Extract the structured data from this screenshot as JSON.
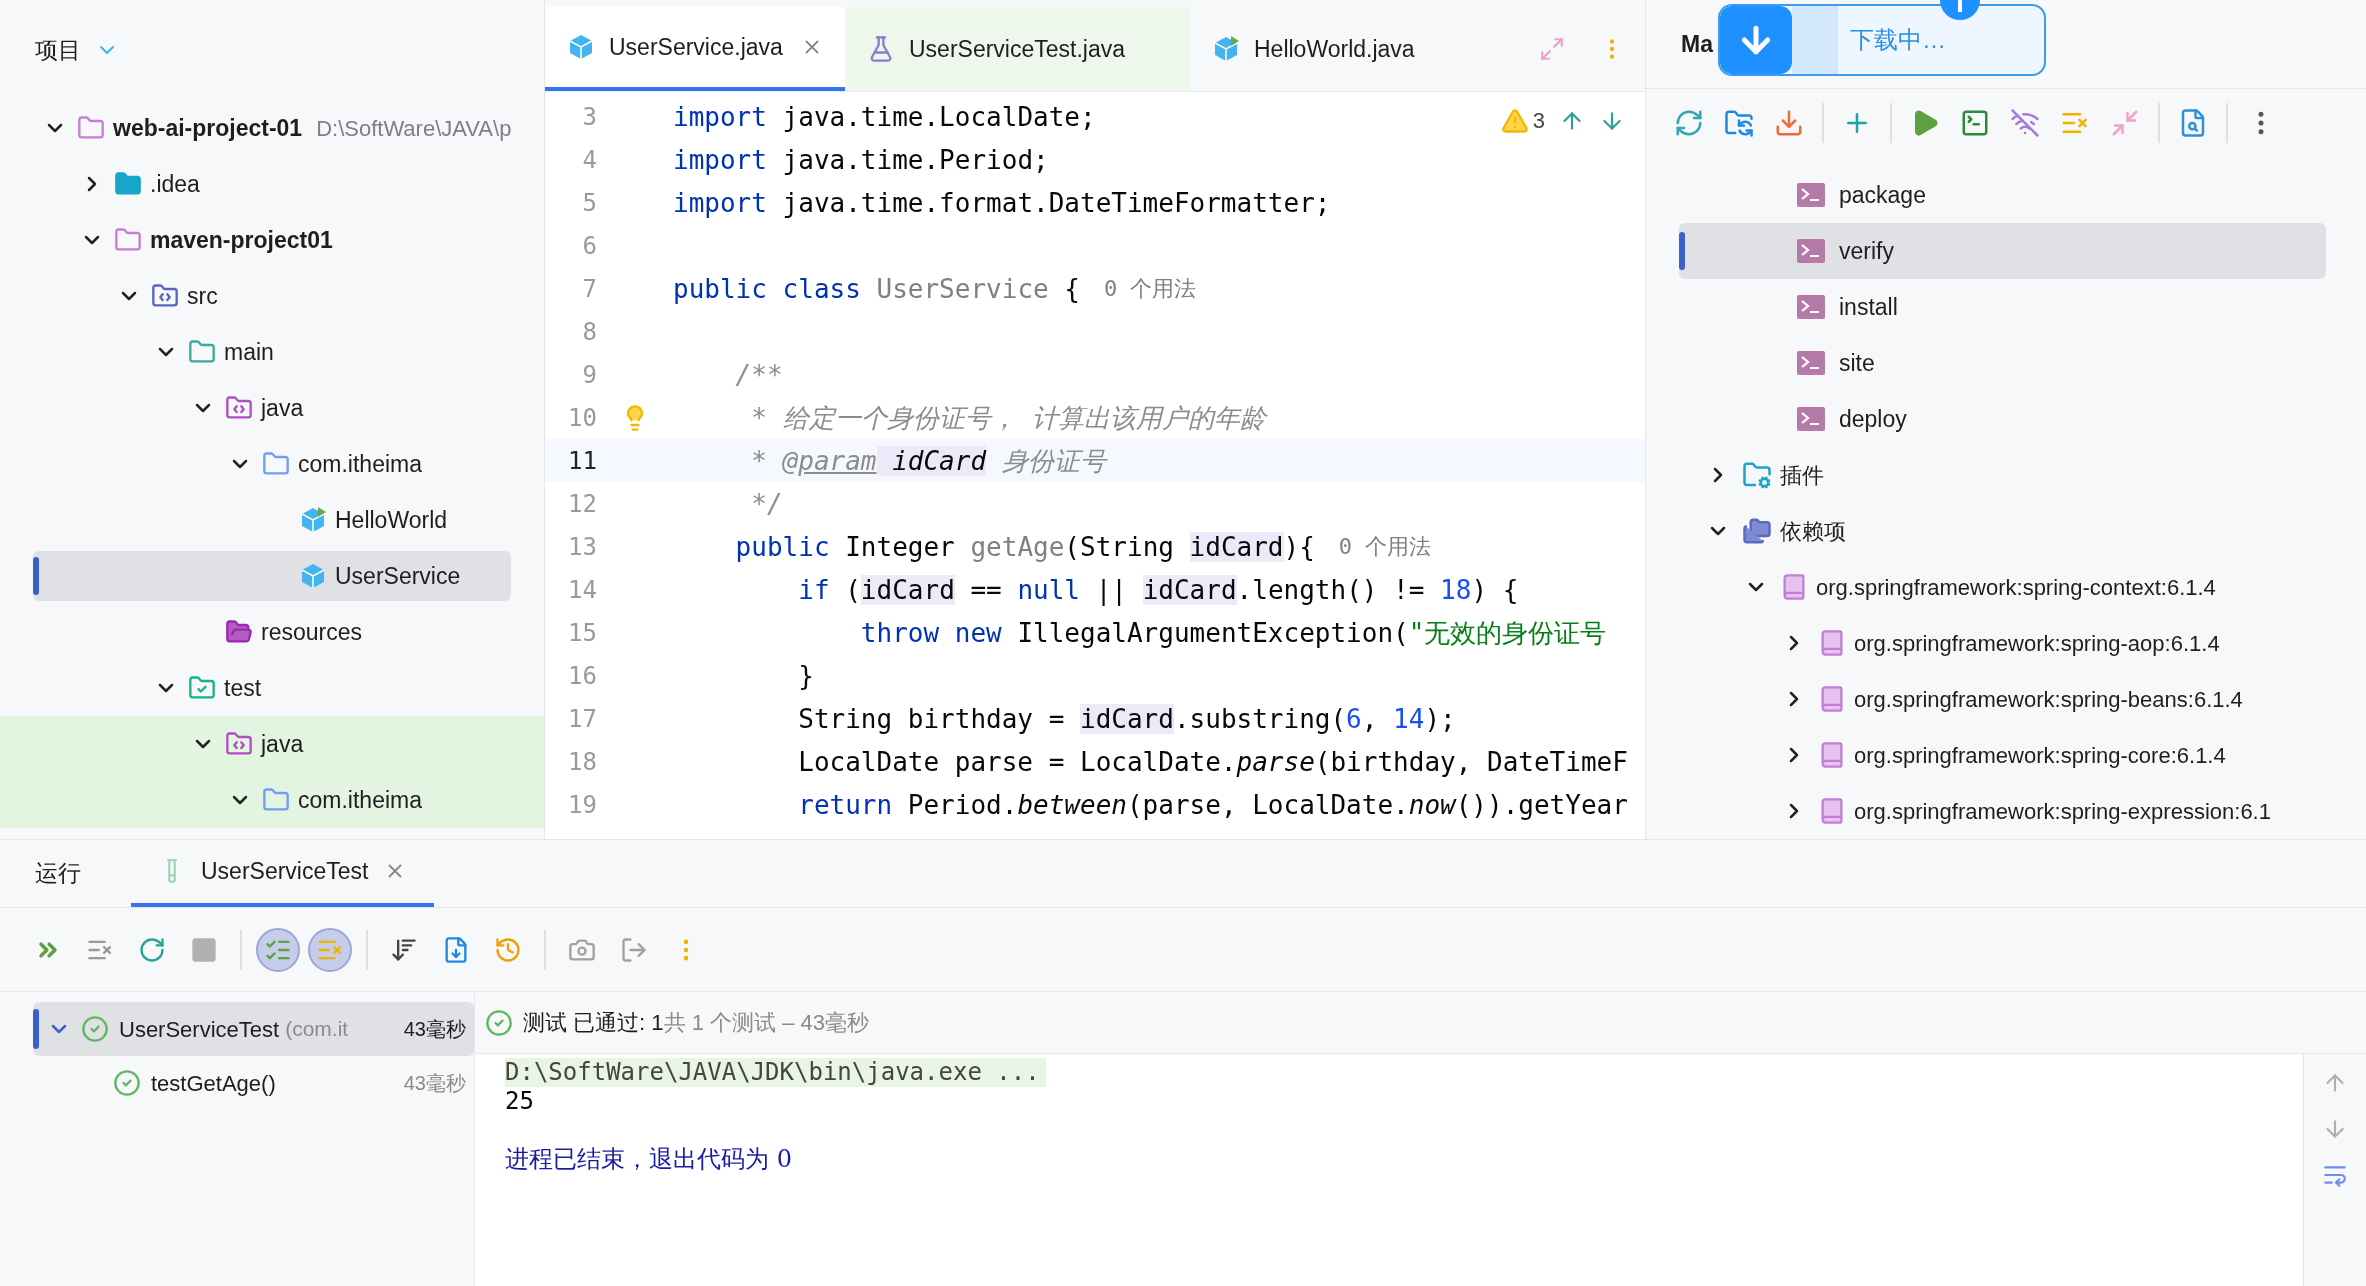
{
  "project_panel": {
    "title": "项目",
    "tree": [
      {
        "label": "web-ai-project-01",
        "kind": "module",
        "hint": "D:\\SoftWare\\JAVA\\p",
        "expanded": true,
        "selected": false,
        "children": [
          {
            "label": ".idea",
            "kind": "idea",
            "expanded": false,
            "selected": false
          },
          {
            "label": "maven-project01",
            "kind": "module",
            "expanded": true,
            "selected": false,
            "children": [
              {
                "label": "src",
                "kind": "src",
                "expanded": true,
                "selected": false,
                "children": [
                  {
                    "label": "main",
                    "kind": "main",
                    "expanded": true,
                    "selected": false,
                    "children": [
                      {
                        "label": "java",
                        "kind": "java",
                        "expanded": true,
                        "selected": false,
                        "children": [
                          {
                            "label": "com.itheima",
                            "kind": "package",
                            "expanded": true,
                            "selected": false,
                            "children": [
                              {
                                "label": "HelloWorld",
                                "kind": "class-run",
                                "selected": false
                              },
                              {
                                "label": "UserService",
                                "kind": "class",
                                "selected": true
                              }
                            ]
                          }
                        ]
                      },
                      {
                        "label": "resources",
                        "kind": "resources",
                        "selected": false
                      }
                    ]
                  },
                  {
                    "label": "test",
                    "kind": "test",
                    "expanded": true,
                    "selected": false,
                    "children": [
                      {
                        "label": "java",
                        "kind": "java-test",
                        "expanded": true,
                        "selected": false,
                        "children": [
                          {
                            "label": "com.itheima",
                            "kind": "package-test",
                            "expanded": true,
                            "selected": false
                          }
                        ]
                      }
                    ]
                  }
                ]
              }
            ]
          }
        ]
      }
    ]
  },
  "editor": {
    "tabs": [
      {
        "label": "UserService.java",
        "kind": "class",
        "selected": true,
        "closable": true
      },
      {
        "label": "UserServiceTest.java",
        "kind": "test",
        "selected": false,
        "closable": false
      },
      {
        "label": "HelloWorld.java",
        "kind": "class-run",
        "selected": false,
        "closable": false
      }
    ],
    "warnings": "3",
    "lines": [
      {
        "number": "3",
        "current": false,
        "tokens": [
          {
            "text": "import",
            "kind": "keyword"
          },
          {
            "text": " java.time.LocalDate;",
            "kind": "plain"
          }
        ]
      },
      {
        "number": "4",
        "current": false,
        "tokens": [
          {
            "text": "import",
            "kind": "keyword"
          },
          {
            "text": " java.time.Period;",
            "kind": "plain"
          }
        ]
      },
      {
        "number": "5",
        "current": false,
        "tokens": [
          {
            "text": "import",
            "kind": "keyword"
          },
          {
            "text": " java.time.format.DateTimeFormatter;",
            "kind": "plain"
          }
        ]
      },
      {
        "number": "6",
        "current": false
      },
      {
        "number": "7",
        "current": false,
        "tokens": [
          {
            "text": "public class ",
            "kind": "keyword"
          },
          {
            "text": "UserService",
            "kind": "unused"
          },
          {
            "text": " {",
            "kind": "plain"
          }
        ],
        "hint": "0 个用法"
      },
      {
        "number": "8",
        "current": false
      },
      {
        "number": "9",
        "current": false,
        "tokens": [
          {
            "text": "    /**",
            "kind": "comment"
          }
        ]
      },
      {
        "number": "10",
        "current": false,
        "intention_bulb": true,
        "tokens": [
          {
            "text": "     * 给定一个身份证号， 计算出该用户的年龄",
            "kind": "comment"
          }
        ]
      },
      {
        "number": "11",
        "current": true,
        "tokens": [
          {
            "text": "     * ",
            "kind": "comment"
          },
          {
            "text": "@param",
            "kind": "doc-tag"
          },
          {
            "text": " idCard",
            "kind": "doc-param"
          },
          {
            "text": " 身份证号",
            "kind": "comment"
          }
        ]
      },
      {
        "number": "12",
        "current": false,
        "tokens": [
          {
            "text": "     */",
            "kind": "comment"
          }
        ]
      },
      {
        "number": "13",
        "current": false,
        "tokens": [
          {
            "text": "    public",
            "kind": "keyword"
          },
          {
            "text": " Integer ",
            "kind": "plain"
          },
          {
            "text": "getAge",
            "kind": "unused"
          },
          {
            "text": "(String ",
            "kind": "plain"
          },
          {
            "text": "idCard",
            "kind": "highlight"
          },
          {
            "text": "){",
            "kind": "plain"
          }
        ],
        "hint": "0 个用法"
      },
      {
        "number": "14",
        "current": false,
        "tokens": [
          {
            "text": "        if",
            "kind": "keyword"
          },
          {
            "text": " (",
            "kind": "plain"
          },
          {
            "text": "idCard",
            "kind": "highlight"
          },
          {
            "text": " == ",
            "kind": "plain"
          },
          {
            "text": "null",
            "kind": "keyword"
          },
          {
            "text": " || ",
            "kind": "plain"
          },
          {
            "text": "idCard",
            "kind": "highlight"
          },
          {
            "text": ".length() != ",
            "kind": "plain"
          },
          {
            "text": "18",
            "kind": "number"
          },
          {
            "text": ") {",
            "kind": "plain"
          }
        ]
      },
      {
        "number": "15",
        "current": false,
        "tokens": [
          {
            "text": "            throw new",
            "kind": "keyword"
          },
          {
            "text": " IllegalArgumentException(",
            "kind": "plain"
          },
          {
            "text": "\"无效的身份证号",
            "kind": "string"
          }
        ]
      },
      {
        "number": "16",
        "current": false,
        "tokens": [
          {
            "text": "        }",
            "kind": "plain"
          }
        ]
      },
      {
        "number": "17",
        "current": false,
        "tokens": [
          {
            "text": "        String birthday = ",
            "kind": "plain"
          },
          {
            "text": "idCard",
            "kind": "highlight"
          },
          {
            "text": ".substring(",
            "kind": "plain"
          },
          {
            "text": "6",
            "kind": "number"
          },
          {
            "text": ", ",
            "kind": "plain"
          },
          {
            "text": "14",
            "kind": "number"
          },
          {
            "text": ");",
            "kind": "plain"
          }
        ]
      },
      {
        "number": "18",
        "current": false,
        "tokens": [
          {
            "text": "        LocalDate parse = LocalDate.",
            "kind": "plain"
          },
          {
            "text": "parse",
            "kind": "static"
          },
          {
            "text": "(birthday, DateTimeF",
            "kind": "plain"
          }
        ]
      },
      {
        "number": "19",
        "current": false,
        "tokens": [
          {
            "text": "        return",
            "kind": "keyword"
          },
          {
            "text": " Period.",
            "kind": "plain"
          },
          {
            "text": "between",
            "kind": "static"
          },
          {
            "text": "(parse, LocalDate.",
            "kind": "plain"
          },
          {
            "text": "now",
            "kind": "static"
          },
          {
            "text": "()).getYear",
            "kind": "plain"
          }
        ]
      }
    ]
  },
  "maven_panel": {
    "title": "Ma",
    "download_popup": {
      "text": "下载中…"
    },
    "toolbar_groups": [
      [
        {
          "kind": "refresh"
        },
        {
          "kind": "folder-sync"
        },
        {
          "kind": "download"
        }
      ],
      [
        {
          "kind": "add"
        }
      ],
      [
        {
          "kind": "run"
        },
        {
          "kind": "terminal"
        },
        {
          "kind": "offline"
        },
        {
          "kind": "clear"
        },
        {
          "kind": "collapse"
        }
      ],
      [
        {
          "kind": "analyze"
        }
      ],
      [
        {
          "kind": "more"
        }
      ]
    ],
    "goals": [
      {
        "label": "package",
        "selected": false
      },
      {
        "label": "verify",
        "selected": true
      },
      {
        "label": "install",
        "selected": false
      },
      {
        "label": "site",
        "selected": false
      },
      {
        "label": "deploy",
        "selected": false
      }
    ],
    "tree": [
      {
        "label": "插件",
        "kind": "plugins",
        "expanded": false,
        "selected": false
      },
      {
        "label": "依赖项",
        "kind": "dependencies",
        "expanded": true,
        "selected": false,
        "children": [
          {
            "label": "org.springframework:spring-context:6.1.4",
            "kind": "library",
            "expanded": true,
            "selected": false,
            "children": [
              {
                "label": "org.springframework:spring-aop:6.1.4",
                "kind": "library",
                "expanded": false,
                "selected": false
              },
              {
                "label": "org.springframework:spring-beans:6.1.4",
                "kind": "library",
                "expanded": false,
                "selected": false
              },
              {
                "label": "org.springframework:spring-core:6.1.4",
                "kind": "library",
                "expanded": false,
                "selected": false
              },
              {
                "label": "org.springframework:spring-expression:6.1",
                "kind": "library",
                "expanded": false,
                "selected": false
              }
            ]
          }
        ]
      }
    ]
  },
  "run_panel": {
    "title": "运行",
    "tabs": [
      {
        "label": "UserServiceTest",
        "selected": true
      }
    ],
    "toolbar_groups": [
      [
        {
          "kind": "run-all"
        },
        {
          "kind": "clear"
        },
        {
          "kind": "rerun"
        },
        {
          "kind": "stop"
        }
      ],
      [
        {
          "kind": "show-passed",
          "on": true
        },
        {
          "kind": "show-ignored",
          "on": true
        }
      ],
      [
        {
          "kind": "sort"
        },
        {
          "kind": "import"
        },
        {
          "kind": "history"
        }
      ],
      [
        {
          "kind": "camera"
        },
        {
          "kind": "export"
        },
        {
          "kind": "more"
        }
      ]
    ],
    "tests": [
      {
        "label": "UserServiceTest",
        "detail": "(com.it",
        "time": "43毫秒",
        "kind": "passed",
        "expanded": true,
        "selected": true,
        "children": [
          {
            "label": "testGetAge()",
            "time": "43毫秒",
            "kind": "passed",
            "selected": false
          }
        ]
      }
    ],
    "status_passed": "测试 已通过: 1",
    "status_summary": "共 1 个测试 – 43毫秒",
    "console": [
      {
        "text": "D:\\SoftWare\\JAVA\\JDK\\bin\\java.exe ...",
        "kind": "command"
      },
      {
        "text": "25",
        "kind": "output"
      },
      {
        "kind": "blank"
      },
      {
        "text": "进程已结束，退出代码为 0",
        "kind": "exit"
      }
    ]
  }
}
